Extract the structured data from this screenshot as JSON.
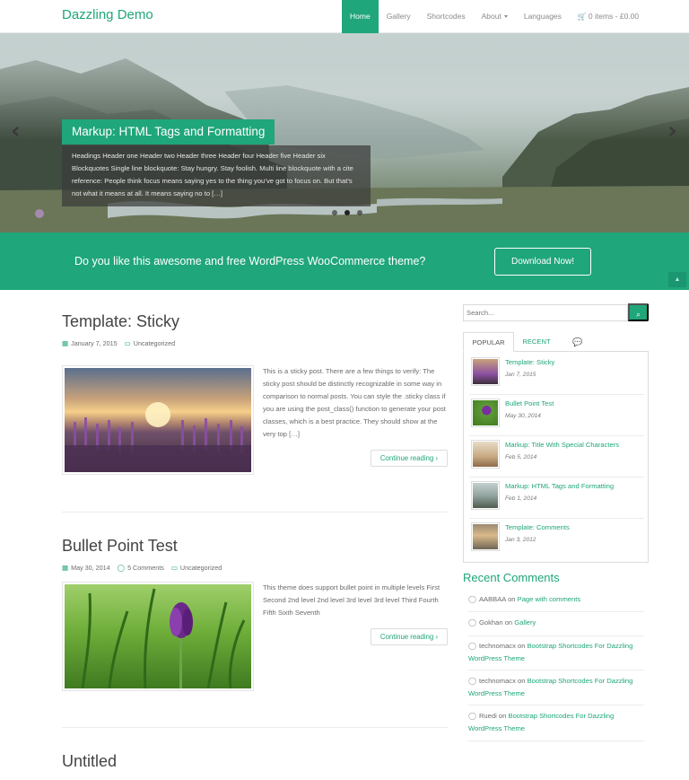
{
  "site": {
    "brand": "Dazzling Demo"
  },
  "nav": {
    "items": [
      {
        "label": "Home",
        "active": true
      },
      {
        "label": "Gallery"
      },
      {
        "label": "Shortcodes"
      },
      {
        "label": "About"
      },
      {
        "label": "Languages"
      }
    ],
    "cart": "0 items - £0.00"
  },
  "slider": {
    "title": "Markup: HTML Tags and Formatting",
    "caption": "Headings Header one Header two Header three Header four Header five Header six Blockquotes Single line blockquote: Stay hungry. Stay foolish. Multi line blockquote with a cite reference: People think focus means saying yes to the thing you’ve got to focus on. But that’s not what it means at all. It means saying no to […]",
    "slide_count": 3,
    "active_slide": 2
  },
  "cta": {
    "text": "Do you like this awesome and free WordPress WooCommerce theme?",
    "button": "Download Now!"
  },
  "posts": [
    {
      "title": "Template: Sticky",
      "date": "January 7, 2015",
      "category": "Uncategorized",
      "excerpt": "This is a sticky post. There are a few things to verify: The sticky post should be distinctly recognizable in some way in comparison to normal posts. You can style the .sticky class if you are using the post_class() function to generate your post classes, which is a best practice. They should show at the very top […]",
      "read_more": "Continue reading"
    },
    {
      "title": "Bullet Point Test",
      "date": "May 30, 2014",
      "comments": "5 Comments",
      "category": "Uncategorized",
      "excerpt": "This theme does support bullet point in multiple levels First Second 2nd level 2nd level 3rd level 3rd level Third Fourth Fifth Sixth Seventh",
      "read_more": "Continue reading"
    },
    {
      "title": "Untitled"
    }
  ],
  "sidebar": {
    "search_placeholder": "Search...",
    "tabs": [
      "POPULAR",
      "RECENT"
    ],
    "popular": [
      {
        "title": "Template: Sticky",
        "date": "Jan 7, 2015"
      },
      {
        "title": "Bullet Point Test",
        "date": "May 30, 2014"
      },
      {
        "title": "Markup: Title With Special Characters",
        "date": "Feb 5, 2014"
      },
      {
        "title": "Markup: HTML Tags and Formatting",
        "date": "Feb 1, 2014"
      },
      {
        "title": "Template: Comments",
        "date": "Jan 3, 2012"
      }
    ],
    "recent_comments_heading": "Recent Comments",
    "recent_comments": [
      {
        "author": "AABBAA",
        "on": "on",
        "post": "Page with comments"
      },
      {
        "author": "Gokhan",
        "on": "on",
        "post": "Gallery"
      },
      {
        "author": "technomacx",
        "on": "on",
        "post": "Bootstrap Shortcodes For Dazzling WordPress Theme"
      },
      {
        "author": "technomacx",
        "on": "on",
        "post": "Bootstrap Shortcodes For Dazzling WordPress Theme"
      },
      {
        "author": "Ruedi",
        "on": "on",
        "post": "Bootstrap Shortcodes For Dazzling WordPress Theme"
      }
    ]
  },
  "colors": {
    "accent": "#1fa67a",
    "text": "#6b6b6b",
    "heading": "#444444"
  }
}
